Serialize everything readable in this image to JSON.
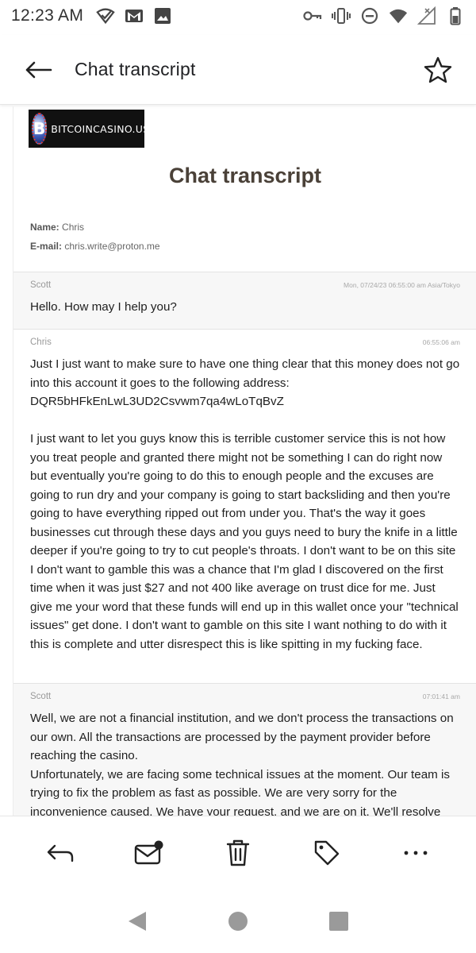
{
  "status_bar": {
    "time": "12:23 AM",
    "left_icons": [
      "wifi-check-icon",
      "gmail-icon",
      "image-icon"
    ],
    "right_icons": [
      "key-icon",
      "vibrate-icon",
      "dnd-icon",
      "wifi-icon",
      "no-signal-icon",
      "battery-icon"
    ]
  },
  "app_bar": {
    "title": "Chat transcript",
    "back_icon": "arrow-left-icon",
    "star_icon": "star-outline-icon"
  },
  "email": {
    "logo_text": "BITCOINCASINO.US",
    "logo_letter": "B",
    "title": "Chat transcript",
    "name_label": "Name:",
    "name_value": "Chris",
    "email_label": "E-mail:",
    "email_value": "chris.write@proton.me",
    "messages": [
      {
        "sender": "Scott",
        "time": "Mon, 07/24/23 06:55:00 am Asia/Tokyo",
        "body": "Hello. How may I help you?"
      },
      {
        "sender": "Chris",
        "time": "06:55:06 am",
        "body": "Just I just want to make sure to have one thing clear that this money does not go into this account it goes to the following address: DQR5bHFkEnLwL3UD2Csvwm7qa4wLoTqBvZ\n\nI just want to let you guys know this is terrible customer service this is not how you treat people and granted there might not be something I can do right now but eventually you're going to do this to enough people and the excuses are going to run dry and your company is going to start backsliding and then you're going to have everything ripped out from under you. That's the way it goes businesses cut through these days and you guys need to bury the knife in a little deeper if you're going to try to cut people's throats. I don't want to be on this site I don't want to gamble this was a chance that I'm glad I discovered on the first time when it was just $27 and not 400 like average on trust dice for me. Just give me your word that these funds will end up in this wallet once your \"technical issues\" get done. I don't want to gamble on this site I want nothing to do with it this is complete and utter disrespect this is like spitting in my fucking face."
      },
      {
        "sender": "Scott",
        "time": "07:01:41 am",
        "body": "Well, we are not a financial institution, and we don't process the transactions on our own. All the transactions are processed by the payment provider before reaching the casino.\nUnfortunately, we are facing some technical issues at the moment. Our team is trying to fix the problem as fast as possible. We are very sorry for the inconvenience caused. We have your request, and we are on it. We'll resolve"
      }
    ]
  },
  "bottom_bar": {
    "actions": [
      "reply-icon",
      "mark-unread-icon",
      "delete-icon",
      "label-icon",
      "more-icon"
    ]
  },
  "nav_bar": {
    "buttons": [
      "nav-back-icon",
      "nav-home-icon",
      "nav-recents-icon"
    ]
  }
}
